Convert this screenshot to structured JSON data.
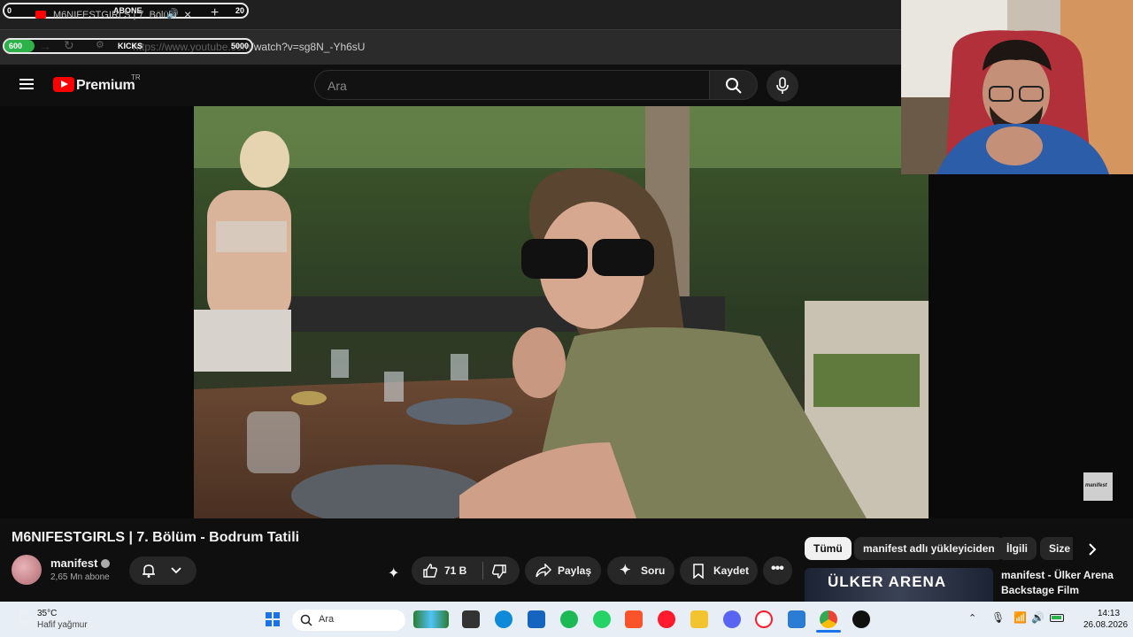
{
  "browser": {
    "tab_title": "M6NIFESTGIRLS | 7. Bölüm",
    "url": "https://www.youtube.com/watch?v=sg8N_-Yh6sU",
    "overlay_top": {
      "left": "0",
      "label": "ABONE",
      "right": "20"
    },
    "overlay_bottom": {
      "left": "600",
      "label": "KICKS",
      "right": "5000"
    },
    "new_tab": "+",
    "close_tab": "×"
  },
  "header": {
    "logo_text": "Premium",
    "region": "TR",
    "search_placeholder": "Ara"
  },
  "video": {
    "title": "M6NIFESTGIRLS | 7. Bölüm - Bodrum Tatili",
    "watermark": "manifest",
    "channel": "manifest",
    "subscribers": "2,65 Mn abone",
    "likes": "71 B",
    "share_label": "Paylaş",
    "ask_label": "Soru",
    "save_label": "Kaydet"
  },
  "chips": [
    "Tümü",
    "manifest adlı yükleyiciden",
    "İlgili",
    "Size"
  ],
  "recommendation": {
    "thumb_text": "ÜLKER ARENA",
    "title_line1": "manifest - Ülker Arena",
    "title_line2": "Backstage Film"
  },
  "taskbar": {
    "weather_temp": "35°C",
    "weather_desc": "Hafif yağmur",
    "search_label": "Ara",
    "time": "14:13",
    "date": "26.08.2026"
  },
  "colors": {
    "yt_red": "#ff0000",
    "accent_green": "#2db24a"
  }
}
